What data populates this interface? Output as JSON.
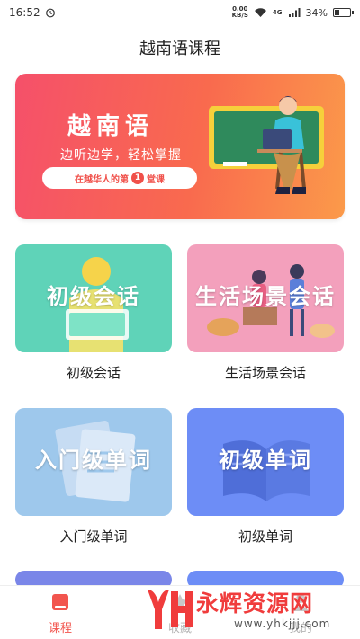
{
  "status_bar": {
    "time": "16:52",
    "net_speed_value": "0.00",
    "net_speed_unit": "KB/S",
    "signal": "4G",
    "battery": "34%",
    "battery_level": 0.34
  },
  "header": {
    "title": "越南语课程"
  },
  "hero": {
    "title": "越南语",
    "subtitle": "边听边学，轻松掌握",
    "pill_prefix": "在越华人的第",
    "pill_number": "1",
    "pill_suffix": "堂课"
  },
  "courses": [
    {
      "art_text": "初级会话",
      "label": "初级会话"
    },
    {
      "art_text": "生活场景会话",
      "label": "生活场景会话"
    },
    {
      "art_text": "入门级单词",
      "label": "入门级单词"
    },
    {
      "art_text": "初级单词",
      "label": "初级单词"
    }
  ],
  "bottom_nav": {
    "items": [
      {
        "label": "课程",
        "icon": "book-icon",
        "active": true
      },
      {
        "label": "收藏",
        "icon": "star-icon",
        "active": false
      },
      {
        "label": "我的",
        "icon": "user-icon",
        "active": false
      }
    ]
  },
  "watermark": {
    "brand": "永辉资源网",
    "url": "www.yhkjjj.com"
  },
  "colors": {
    "accent": "#f2554e",
    "hero_gradient_start": "#f5506a",
    "hero_gradient_end": "#fb9a4a",
    "card_teal": "#5fd3b8",
    "card_pink": "#f3a0bc",
    "card_light_blue": "#9ec8ec",
    "card_blue": "#6d8df6"
  }
}
